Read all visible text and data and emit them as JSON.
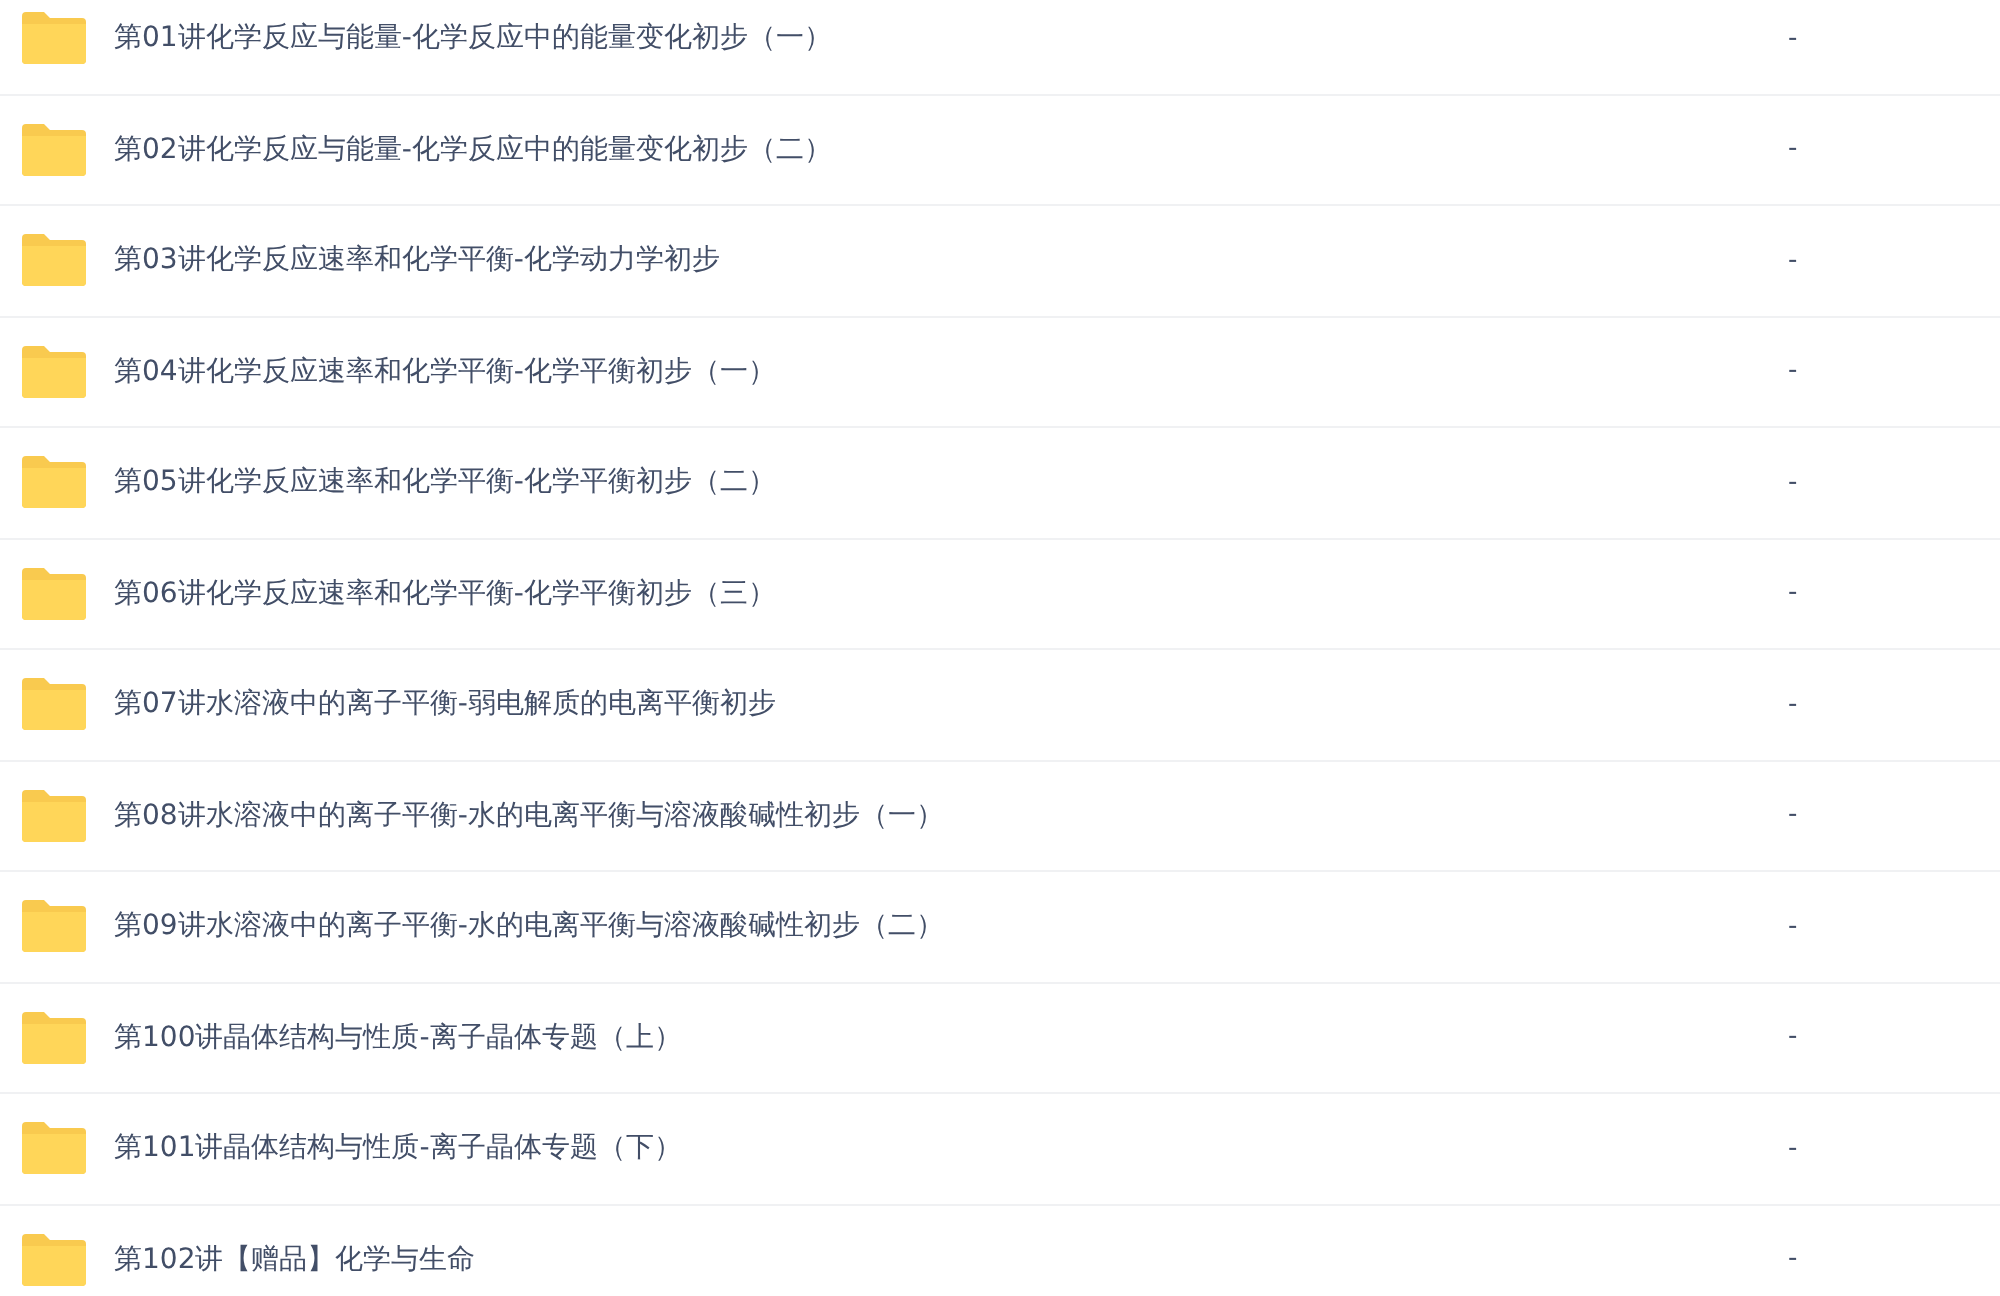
{
  "files": [
    {
      "name": "第01讲化学反应与能量-化学反应中的能量变化初步（一）",
      "column_2": "-"
    },
    {
      "name": "第02讲化学反应与能量-化学反应中的能量变化初步（二）",
      "column_2": "-"
    },
    {
      "name": "第03讲化学反应速率和化学平衡-化学动力学初步",
      "column_2": "-"
    },
    {
      "name": "第04讲化学反应速率和化学平衡-化学平衡初步（一）",
      "column_2": "-"
    },
    {
      "name": "第05讲化学反应速率和化学平衡-化学平衡初步（二）",
      "column_2": "-"
    },
    {
      "name": "第06讲化学反应速率和化学平衡-化学平衡初步（三）",
      "column_2": "-"
    },
    {
      "name": "第07讲水溶液中的离子平衡-弱电解质的电离平衡初步",
      "column_2": "-"
    },
    {
      "name": "第08讲水溶液中的离子平衡-水的电离平衡与溶液酸碱性初步（一）",
      "column_2": "-"
    },
    {
      "name": "第09讲水溶液中的离子平衡-水的电离平衡与溶液酸碱性初步（二）",
      "column_2": "-"
    },
    {
      "name": "第100讲晶体结构与性质-离子晶体专题（上）",
      "column_2": "-"
    },
    {
      "name": "第101讲晶体结构与性质-离子晶体专题（下）",
      "column_2": "-"
    },
    {
      "name": "第102讲【赠品】化学与生命",
      "column_2": "-"
    }
  ]
}
